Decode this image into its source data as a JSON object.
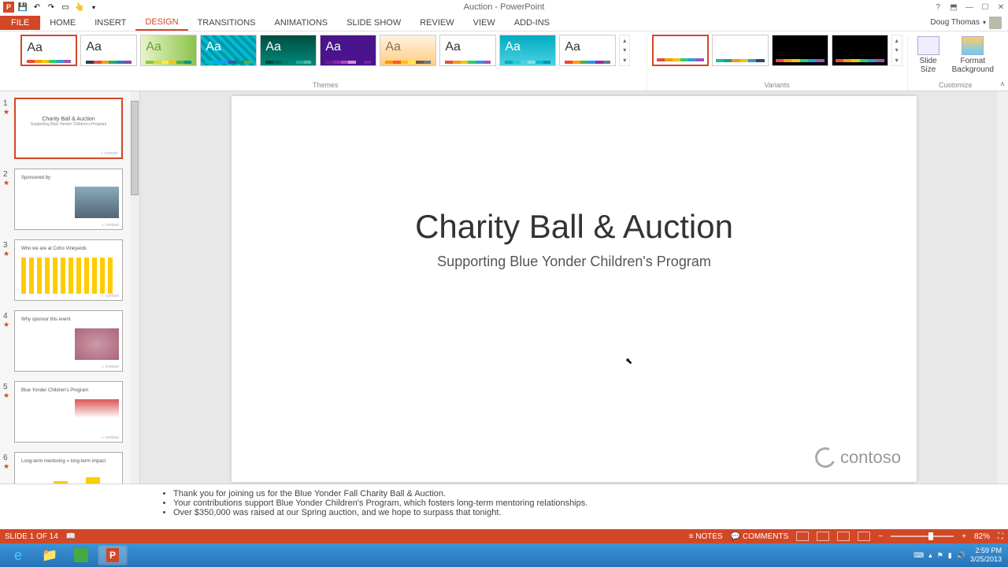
{
  "app": {
    "title": "Auction - PowerPoint",
    "user_name": "Doug Thomas"
  },
  "qat": [
    "ppt-icon",
    "save",
    "undo",
    "redo",
    "start-slideshow",
    "touch-mode"
  ],
  "tabs": [
    "FILE",
    "HOME",
    "INSERT",
    "DESIGN",
    "TRANSITIONS",
    "ANIMATIONS",
    "SLIDE SHOW",
    "REVIEW",
    "VIEW",
    "ADD-INS"
  ],
  "tabs_active": "DESIGN",
  "ribbon": {
    "themes_label": "Themes",
    "variants_label": "Variants",
    "customize_label": "Customize",
    "slide_size": "Slide\nSize",
    "format_bg": "Format\nBackground"
  },
  "slides": [
    {
      "num": "1",
      "title": "Charity Ball & Auction",
      "sub": "Supporting Blue Yonder Children's Program"
    },
    {
      "num": "2",
      "title": "Sponsored by"
    },
    {
      "num": "3",
      "title": "Who we are at Coho Vineyards"
    },
    {
      "num": "4",
      "title": "Why sponsor this event"
    },
    {
      "num": "5",
      "title": "Blue Yonder Children's Program"
    },
    {
      "num": "6",
      "title": "Long-term mentoring = long-term impact"
    }
  ],
  "current_slide": {
    "title": "Charity Ball & Auction",
    "subtitle": "Supporting Blue Yonder Children's Program",
    "logo_text": "contoso"
  },
  "notes": [
    "Thank you for joining us for the Blue Yonder Fall Charity Ball & Auction.",
    "Your contributions support Blue Yonder Children's Program, which fosters long-term mentoring relationships.",
    "Over $350,000 was raised at our Spring auction, and we hope to surpass that tonight."
  ],
  "status": {
    "slide_info": "SLIDE 1 OF 14",
    "notes_btn": "NOTES",
    "comments_btn": "COMMENTS",
    "zoom": "82%"
  },
  "tray": {
    "time": "2:59 PM",
    "date": "3/25/2013"
  },
  "theme_colors": [
    [
      "#e74c3c",
      "#f39c12",
      "#f1c40f",
      "#2ecc71",
      "#3498db",
      "#9b59b6"
    ],
    [
      "#2c3e50",
      "#e74c3c",
      "#f39c12",
      "#27ae60",
      "#2980b9",
      "#8e44ad"
    ],
    [
      "#8bc34a",
      "#cddc39",
      "#ffeb3b",
      "#ffc107",
      "#4caf50",
      "#009688"
    ],
    [
      "#00bcd4",
      "#03a9f4",
      "#2196f3",
      "#3f51b5",
      "#009688",
      "#4caf50"
    ],
    [
      "#004d40",
      "#00695c",
      "#00796b",
      "#00897b",
      "#26a69a",
      "#4db6ac"
    ],
    [
      "#6a1b9a",
      "#8e24aa",
      "#ab47bc",
      "#ce93d8",
      "#4a148c",
      "#7b1fa2"
    ],
    [
      "#ff9800",
      "#ff5722",
      "#ffc107",
      "#ffeb3b",
      "#795548",
      "#607d8b"
    ],
    [
      "#e74c3c",
      "#f39c12",
      "#f1c40f",
      "#2ecc71",
      "#3498db",
      "#9b59b6"
    ],
    [
      "#00acc1",
      "#26c6da",
      "#4dd0e1",
      "#80deea",
      "#00bcd4",
      "#0097a7"
    ],
    [
      "#f44336",
      "#ff9800",
      "#4caf50",
      "#2196f3",
      "#9c27b0",
      "#607d8b"
    ]
  ],
  "variant_colors": [
    [
      "#e74c3c",
      "#f39c12",
      "#f1c40f",
      "#2ecc71",
      "#3498db",
      "#9b59b6"
    ],
    [
      "#1abc9c",
      "#16a085",
      "#f39c12",
      "#f1c40f",
      "#3498db",
      "#34495e"
    ],
    [
      "#e74c3c",
      "#f39c12",
      "#f1c40f",
      "#2ecc71",
      "#3498db",
      "#9b59b6"
    ],
    [
      "#e74c3c",
      "#f39c12",
      "#f1c40f",
      "#2ecc71",
      "#3498db",
      "#9b59b6"
    ]
  ]
}
